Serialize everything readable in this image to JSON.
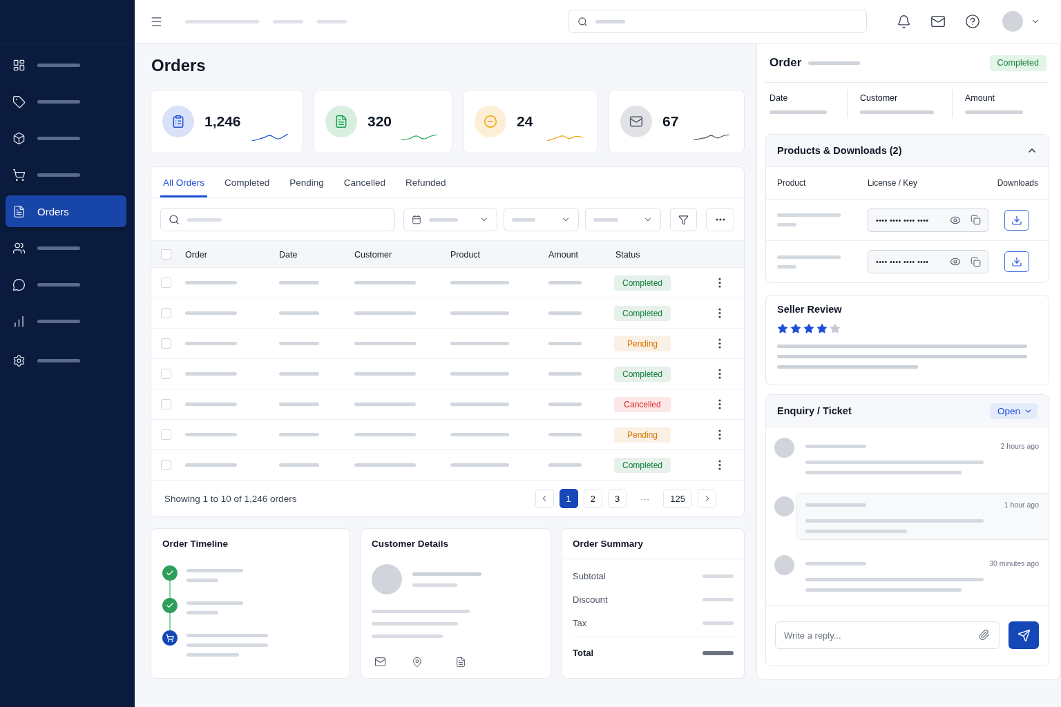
{
  "sidebar": {
    "items": [
      {
        "selected": false
      },
      {
        "selected": false
      },
      {
        "selected": false
      },
      {
        "selected": false
      },
      {
        "label": "Orders",
        "selected": true
      },
      {
        "selected": false
      },
      {
        "selected": false
      },
      {
        "selected": false
      },
      {
        "selected": false
      }
    ]
  },
  "page": {
    "title": "Orders"
  },
  "stats": [
    {
      "value": "1,246",
      "color": "#1d4ed8"
    },
    {
      "value": "320",
      "color": "#16a34a"
    },
    {
      "value": "24",
      "color": "#f59e0b"
    },
    {
      "value": "67",
      "color": "#4b5563"
    }
  ],
  "tabs": [
    {
      "label": "All Orders",
      "selected": true
    },
    {
      "label": "Completed",
      "selected": false
    },
    {
      "label": "Pending",
      "selected": false
    },
    {
      "label": "Cancelled",
      "selected": false
    },
    {
      "label": "Refunded",
      "selected": false
    }
  ],
  "table": {
    "all_checked": false,
    "columns": [
      "Order",
      "Date",
      "Customer",
      "Product",
      "Amount",
      "Status"
    ],
    "rows": [
      {
        "checked": false,
        "status": "Completed",
        "color": "#15803d"
      },
      {
        "checked": false,
        "status": "Completed",
        "color": "#15803d"
      },
      {
        "checked": false,
        "status": "Pending",
        "color": "#d97706"
      },
      {
        "checked": false,
        "status": "Completed",
        "color": "#15803d"
      },
      {
        "checked": false,
        "status": "Cancelled",
        "color": "#dc2626"
      },
      {
        "checked": false,
        "status": "Pending",
        "color": "#d97706"
      },
      {
        "checked": false,
        "status": "Completed",
        "color": "#15803d"
      }
    ]
  },
  "pagination": {
    "summary": "Showing 1 to 10 of 1,246 orders",
    "pages": [
      {
        "label": "1",
        "kind": "page",
        "selected": true
      },
      {
        "label": "2",
        "kind": "page",
        "selected": false
      },
      {
        "label": "3",
        "kind": "page",
        "selected": false
      },
      {
        "label": "···",
        "kind": "ellipsis"
      },
      {
        "label": "125",
        "kind": "page",
        "selected": false
      }
    ]
  },
  "timeline": {
    "title": "Order Timeline",
    "steps": [
      {
        "kind": "done"
      },
      {
        "kind": "done"
      },
      {
        "kind": "current"
      }
    ]
  },
  "customer": {
    "title": "Customer Details"
  },
  "summary": {
    "title": "Order Summary",
    "rows": [
      {
        "label": "Subtotal",
        "kind": "line"
      },
      {
        "label": "Discount",
        "kind": "line"
      },
      {
        "label": "Tax",
        "kind": "line"
      },
      {
        "label": "Total",
        "kind": "total"
      }
    ]
  },
  "order": {
    "title": "Order",
    "status": "Completed",
    "fields": [
      "Date",
      "Customer",
      "Amount"
    ]
  },
  "products": {
    "title": "Products & Downloads (2)",
    "expanded": true,
    "columns": [
      "Product",
      "License / Key",
      "Downloads"
    ],
    "rows": [
      {
        "key": "•••• •••• •••• ••••"
      },
      {
        "key": "•••• •••• •••• ••••"
      }
    ]
  },
  "review": {
    "title": "Seller Review",
    "stars": 4
  },
  "ticket": {
    "title": "Enquiry / Ticket",
    "status": "Open",
    "messages": [
      {
        "time": "2 hours ago",
        "selected": false
      },
      {
        "time": "1 hour ago",
        "selected": true
      },
      {
        "time": "30 minutes ago",
        "selected": false
      }
    ],
    "reply": {
      "placeholder": "Write a reply..."
    }
  }
}
